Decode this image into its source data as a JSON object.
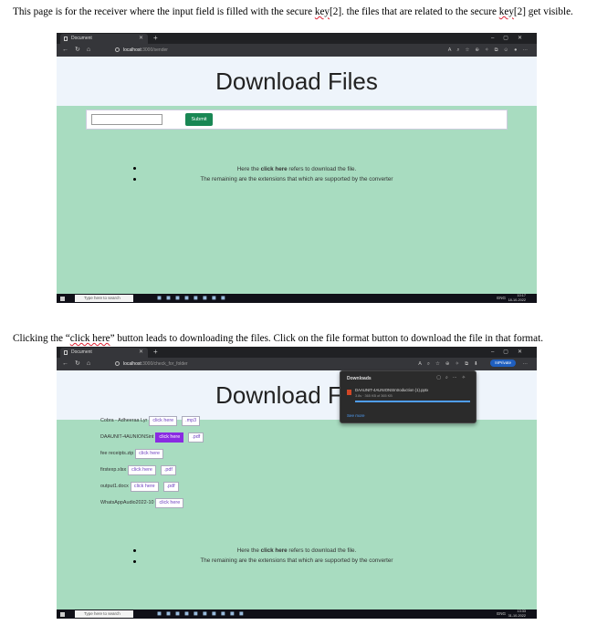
{
  "doc": {
    "para1": {
      "a": "This page is for the receiver where the input field is filled with the secure ",
      "k1": "key",
      "b": "[2]. the files that are related to the secure ",
      "k2": "key",
      "c": "[2]  get visible."
    },
    "para2": {
      "a": "Clicking the “",
      "k": "click here",
      "b": "” button leads to downloading the files. Click on the file format button to download the file in that format."
    }
  },
  "shot1": {
    "tab_title": "Document",
    "url_host": "localhost",
    "url_path": ":3000/sender",
    "page_title": "Download Files",
    "submit_label": "Submit",
    "note_line1_pre": "Here the ",
    "note_line1_bold": "click here",
    "note_line1_post": " refers to download the file.",
    "note_line2": "The remaining are the extensions that which are supported by the converter",
    "search_placeholder": "Type here to search",
    "clock_time": "10:17",
    "clock_date": "18-10-2022",
    "lang": "ENG"
  },
  "shot2": {
    "tab_title": "Document",
    "url_host": "localhost",
    "url_path": ":3000/check_for_folder",
    "page_title": "Download Files",
    "inprivate_label": "InPrivate",
    "downloads": {
      "title": "Downloads",
      "file": "DAAUNIT-4AUNIONSIntroduction (1).pptx",
      "meta": "3.8s · 365 KB of 365 KB",
      "see_more": "See more"
    },
    "files": [
      {
        "name": "Cobra - Adheeraa Lyr",
        "button": "click here",
        "format": ".mp3"
      },
      {
        "name": "DAAUNIT-4AUNIONSint",
        "button": "click here",
        "format": ".pdf"
      },
      {
        "name": "fee receipts.zip",
        "button": "click here",
        "format": ""
      },
      {
        "name": "firstexp.xlsx",
        "button": "click here",
        "format": ".pdf"
      },
      {
        "name": "output1.docx",
        "button": "click here",
        "format": ".pdf"
      },
      {
        "name": "WhatsAppAudio2022-10",
        "button": "click here",
        "format": ""
      }
    ],
    "note_line1_pre": "Here the ",
    "note_line1_bold": "click here",
    "note_line1_post": " refers to download the file.",
    "note_line2": "The remaining are the extensions that which are supported by the converter",
    "search_placeholder": "Type here to search",
    "clock_time": "13:33",
    "clock_date": "31-10-2022",
    "lang": "ENG"
  }
}
